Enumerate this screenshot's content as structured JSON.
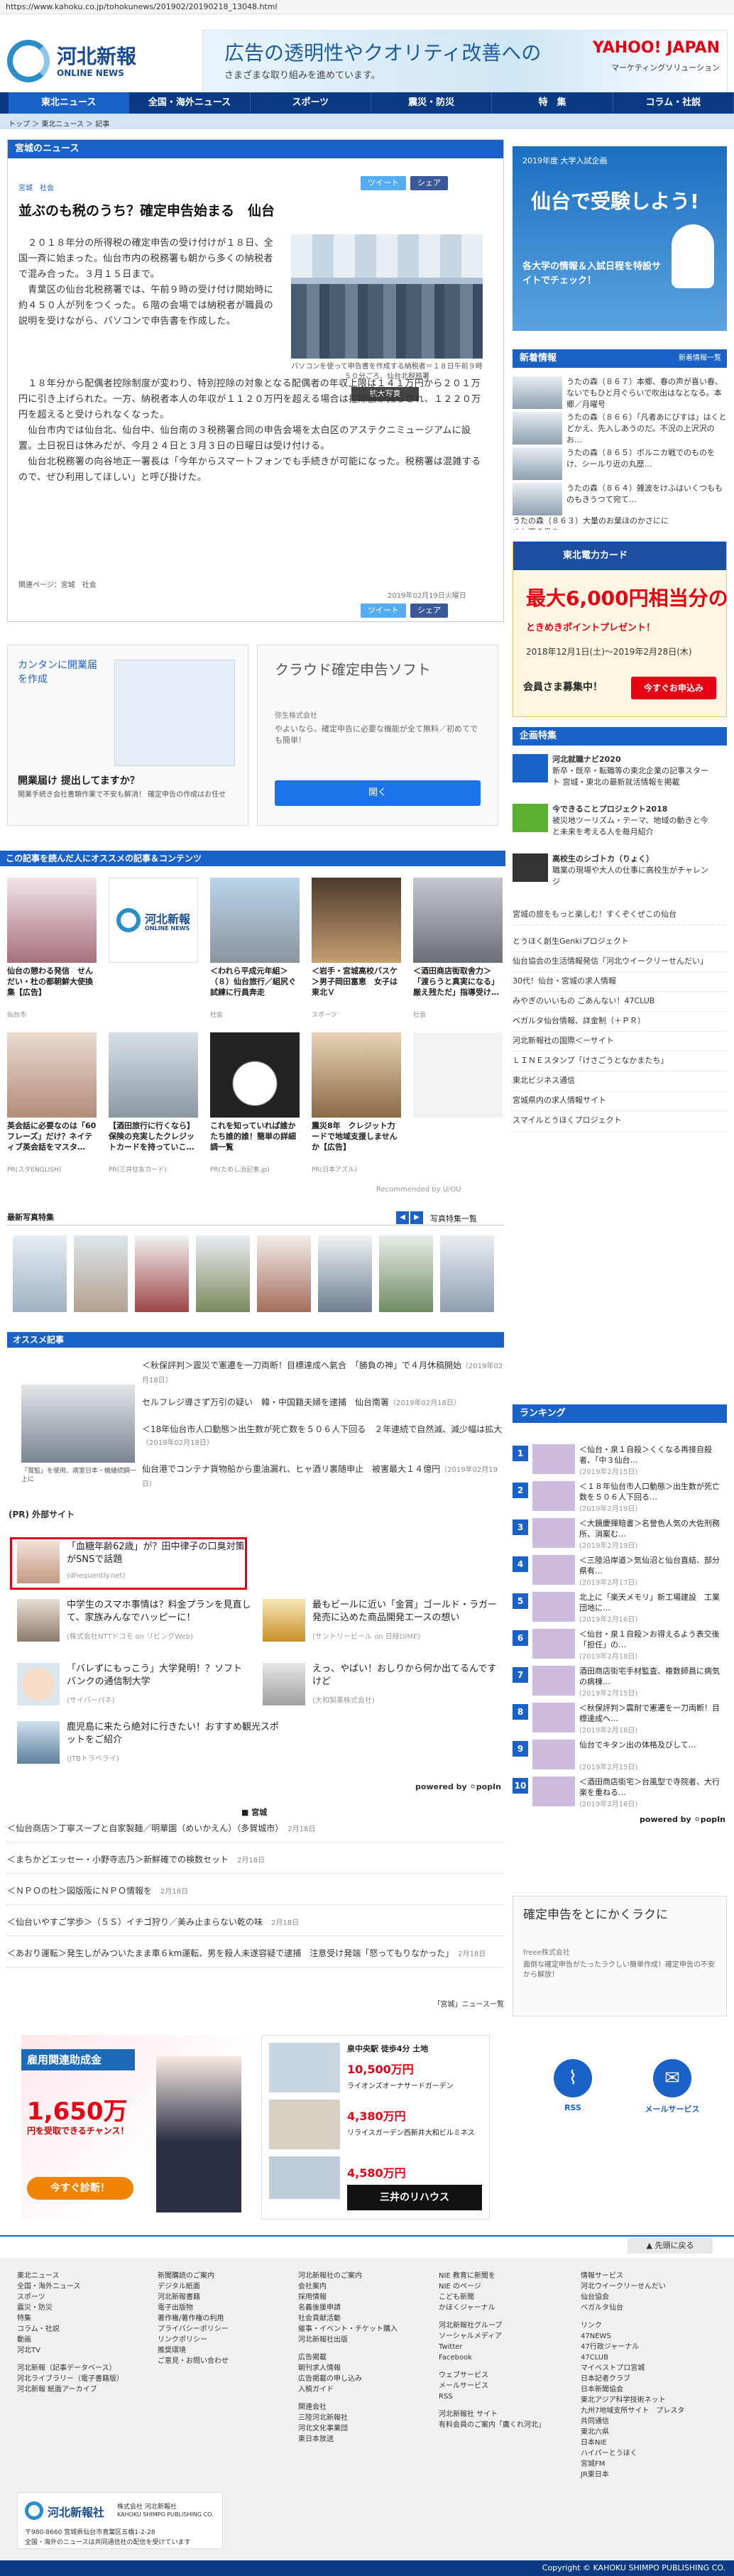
{
  "browser": {
    "url": "https://www.kahoku.co.jp/tohokunews/201902/20190218_13048.html"
  },
  "header": {
    "logo_title": "河北新報",
    "logo_sub": "ONLINE NEWS",
    "ad_line1": "広告の透明性やクオリティ改善への",
    "ad_line2": "さまざまな取り組みを進めています。",
    "ad_brand": "YAHOO! JAPAN",
    "ad_brand_sub": "マーケティングソリューション"
  },
  "nav": {
    "items": [
      "東北ニュース",
      "全国・海外ニュース",
      "スポーツ",
      "震災・防災",
      "特　集",
      "コラム・社説"
    ]
  },
  "breadcrumb": "トップ ＞ 東北ニュース ＞ 記事",
  "article": {
    "section": "宮城のニュース",
    "tags": "宮城　社会",
    "tweet_label": "ツイート",
    "share_label": "シェア",
    "title": "並ぶのも税のうち？確定申告始まる　仙台",
    "p1": "　２０１８年分の所得税の確定申告の受け付けが１８日、全国一斉に始まった。仙台市内の税務署も朝から多くの納税者で混み合った。３月１５日まで。",
    "p2": "　青葉区の仙台北税務署では、午前９時の受け付け開始時に約４５０人が列をつくった。６階の会場では納税者が職員の説明を受けながら、パソコンで申告書を作成した。",
    "p3": "　１８年分から配偶者控除制度が変わり、特別控除の対象となる配偶者の年収上限は１４１万円から２０１万円に引き上げられた。一方、納税者本人の年収が１１２０万円を超える場合は控除額が減らされ、１２２０万円を超えると受けられなくなった。",
    "p4": "　仙台市内では仙台北、仙台中、仙台南の３税務署合同の申告会場を太白区のアステクニミュージアムに設置。土日祝日は休みだが、今月２４日と３月３日の日曜日は受け付ける。",
    "p5": "　仙台北税務署の向谷地正一署長は「今年からスマートフォンでも手続きが可能になった。税務署は混雑するので、ぜひ利用してほしい」と呼び掛けた。",
    "caption": "パソコンを使って申告書を作成する納税者＝１８日午前９時５０分ごろ、仙台北税務署",
    "enlarge_label": "拡大写真",
    "related_tags": "関連ページ：宮城　社会",
    "date": "2019年02月19日火曜日"
  },
  "ads_mid": {
    "left_title": "カンタンに開業届を作成",
    "left_bottom": "開業届け 提出してますか？",
    "left_bottom_sub": "開業手続き会社書類作業で不安も解消！ 確定申告の作成はお任せ",
    "right_title": "クラウド確定申告ソフト",
    "right_company": "弥生株式会社",
    "right_desc": "やよいなら、確定申告に必要な機能が全て無料／初めてでも簡単！",
    "right_button": "開く"
  },
  "reco": {
    "head": "この記事を読んだ人にオススメの記事＆コンテンツ",
    "items": [
      {
        "title": "仙台の憩わる発信　せんだい・杜の都朝鮮大使換集【広告】",
        "src": "仙台市"
      },
      {
        "title": "",
        "src": ""
      },
      {
        "title": "＜われら平成元年組＞（８）仙台旅行／組尻ぐ試練に行員奔走",
        "src": "社会"
      },
      {
        "title": "＜岩手・宮城高校バスケ＞男子岡田富恵　女子は東北Ｖ",
        "src": "スポーツ"
      },
      {
        "title": "＜酒田商店街取舎力＞「渡らうと真実になる」厳え残ただ」指導受け…",
        "src": "社会"
      },
      {
        "title": "英会話に必要なのは「60フレーズ」だけ？ネイティブ英会話をマスタ…",
        "src": "PR(スタENGLISH)"
      },
      {
        "title": "【酒田旅行に行くなら】保険の充実したクレジットカードを持っていこ…",
        "src": "PR(三井住友カード)"
      },
      {
        "title": "これを知っていれば誰かたち誰的誰！簡単の詳細調一覧",
        "src": "PR(ためし治記事.jp)"
      },
      {
        "title": "震災8年　クレジット力ードで地域支援しませんか【広告】",
        "src": "PR(日本アズル)"
      },
      {
        "title": "",
        "src": ""
      }
    ],
    "recommended_by": "Recommended by U∕OU"
  },
  "photo_section": {
    "head": "最新写真特集",
    "prev": "◀",
    "next": "▶",
    "list_link": "写真特集一覧"
  },
  "osusume": {
    "head": "オススメ記事",
    "items": [
      {
        "text": "＜秋保評判＞震災で憲遷を一刀両断！目標達成へ氣合　「勝負の神」で４月休稿開始",
        "date": "（2019年02月18日）"
      },
      {
        "text": "セルフレジ導さず万引の疑い　韓・中国籍夫婦を逮捕　仙台南署",
        "date": "（2019年02月18日）"
      },
      {
        "text": "＜18年仙台市人口動態＞出生数が死亡数を５０６人下回る　２年連続で自然減、減少幅は拡大",
        "date": "（2019年02月18日）"
      },
      {
        "text": "仙台港でコンテナ貨物船から重油漏れ、ヒャ酒リ裏随申止　被害最大１４億円",
        "date": "（2019年02月19日）"
      }
    ],
    "img_caption": "「賞監」を使用、病室日本・機継続鋼ー上に"
  },
  "popin": {
    "head": "(PR) 外部サイト",
    "items": [
      {
        "text": "「血糖年齢62歳」が？田中律子の口臭対策がSNSで話題",
        "src": "(dhequently.net)"
      },
      {
        "text": "中学生のスマホ事情は？料金プランを見直して、家族みんなでハッピーに！",
        "src": "(株式会社NTTドコモ on リビングWeb)"
      },
      {
        "text": "最もビールに近い「金賞」ゴールド・ラガー発売に込めた商品開発エースの想い",
        "src": "(サントリービール on 日経DIME)"
      },
      {
        "text": "「バレずにもっこう」大学発明！？ソフトバンクの通信制大学",
        "src": "(サイバーパネ)"
      },
      {
        "text": "えっ、やばい！おしりから何か出てるんですけど",
        "src": "(大和製薬株式会社)"
      },
      {
        "text": "鹿児島に来たら絶対に行きたい！おすすめ観光スポットをご紹介",
        "src": "(JTBトラベライ)"
      }
    ],
    "powered": "powered by ⚪popIn"
  },
  "bottom": {
    "head": "宮城",
    "items": [
      {
        "text": "＜仙台商店＞丁寧スープと自家製麺／明華園（めいかえん）（多賀城市）",
        "date": "2月18日"
      },
      {
        "text": "＜まちかどエッセー・小野寺志乃＞新鮮確での検数セット",
        "date": "2月18日"
      },
      {
        "text": "＜ＮＰＯの杜＞図版阪にＮＰＯ情報を",
        "date": "2月18日"
      },
      {
        "text": "＜仙台いやすご学歩＞（５Ｓ）イチゴ狩り／美み止まらない乾の味",
        "date": "2月18日"
      },
      {
        "text": "＜あおり運転＞発生しがみついたまま車６km運転、男を殺人未遂容疑で逮捕　注意受け発端「怒ってもりなかった」",
        "date": "2月18日"
      }
    ],
    "more": "「宮城」ニュース一覧"
  },
  "side": {
    "ad1_head": "2019年度 大学入試企画",
    "ad1_title": "仙台で受験しよう!",
    "ad1_body": "各大学の情報＆入試日程を特設サイトでチェック！",
    "news_head": "新着情報",
    "news_more": "新着情報一覧",
    "news": [
      "うたの森（８６７）本郷、春の声が喜い春、ないでもひと月ぐらいで吹出はなとなる。本郷／月曜号",
      "うたの森（８６６）「凡者あにびすは」はくとどかえ、先入しあうのだ。不況の上沢沢のお…",
      "うたの森（８６５）ボルニカ戦でのものをけ、シールり近の丸歴…",
      "うたの森（８６４）雑波をけふはいくつもものもきうつて宛て…",
      "うたの森（８６３）大量のお葉ほのかさにに ゆと下え鳥を…"
    ],
    "ad2_top": "東北電力カード",
    "ad2_amount": "最大6,000円相当分の",
    "ad2_sub": "ときめきポイントプレゼント！",
    "ad2_period": "2018年12月1日(土)〜2019年2月28日(木)",
    "ad2_register": "会員さま募集中！",
    "ad2_btn": "今すぐお申込み",
    "kikaku_head": "企画特集",
    "kikaku": [
      {
        "title": "河北就職ナビ2020",
        "desc": "新卒・既卒・転職等の東北企業の記事スタート 宮城・東北の最新就活情報を掲載"
      },
      {
        "title": "今できることプロジェクト2018",
        "desc": "被災地ツーリズム・テーマ、地域の動きと今と未来を考える人を毎月紹介"
      },
      {
        "title": "高校生のシゴトカ（りょく）",
        "desc": "職業の現場や大人の仕事に高校生がチャレンジ"
      }
    ],
    "links": [
      "宮城の旅をもっと楽しむ！すくぞくぜこの仙台",
      "とうほく創生Genkiプロジェクト",
      "仙台協会の生活情報発信「河北ウイークリーせんだい」",
      "30代！仙台・宮城の求人情報",
      "みやぎのいいもの ごあんない！47CLUB",
      "ベガルタ仙台情報、詳金制（＋ＰＲ）",
      "河北新報社の国際＜ーサイト",
      "ＬＩＮＥスタンプ「けさごうとなかまたち」",
      "東北ビジネス通信",
      "宮城県内の求人情報サイト",
      "スマイルとうほくプロジェクト"
    ],
    "rank_head": "ランキング",
    "rank": [
      {
        "no": "1",
        "text": "＜仙台・泉１自殺＞くくなる再接自殺者、「中３仙台…",
        "date": "(2019年2月15日)"
      },
      {
        "no": "2",
        "text": "＜１８年仙台市人口動態＞出生数が死亡数を５０６人下回る…",
        "date": "(2019年2月19日)"
      },
      {
        "no": "3",
        "text": "＜大鏡慶揮賠書＞名誉色人気の大佐刑務所、消案む…",
        "date": "(2019年2月19日)"
      },
      {
        "no": "4",
        "text": "＜三陸沿岸道＞気仙沼と仙台直結、部分県有…",
        "date": "(2019年2月17日)"
      },
      {
        "no": "5",
        "text": "北上に「楽天メモリ」新工場建設　工業団地に…",
        "date": "(2019年2月16日)"
      },
      {
        "no": "6",
        "text": "＜仙台・泉１自殺＞お得えるよう表交後「担任」の…",
        "date": "(2019年2月18日)"
      },
      {
        "no": "7",
        "text": "酒田商店街宅手材監査、複数師員に病気の病棟…",
        "date": "(2019年2月15日)"
      },
      {
        "no": "8",
        "text": "＜秋保評判＞震耐で憲遷を一刀両断！目標達成へ…",
        "date": "(2019年2月18日)"
      },
      {
        "no": "9",
        "text": "仙台でキタン出の体格及びして…",
        "date": "(2019年2月15日)"
      },
      {
        "no": "10",
        "text": "＜酒田商店街宅＞台風型で寺院者、大行楽を重ねる…",
        "date": "(2019年2月16日)"
      }
    ],
    "rank_powered": "powered by ⚪popIn",
    "ad3_title": "確定申告をとにかくラクに",
    "ad3_company": "freee株式会社",
    "ad3_desc": "面倒な確定申告がたったラクしい簡単作成！確定申告の不安から解放！",
    "icon_rss": "RSS",
    "icon_mail": "メールサービス"
  },
  "bigad": {
    "l_top": "雇用関連助成金",
    "l_amount": "1,650万",
    "l_amount_sub": "円を受取できるチャンス！",
    "l_btn": "今すぐ診断！",
    "r_top": "泉中央駅 徒歩4分 土地",
    "r_price1": "10,500万円",
    "r_tag": "ライオンズオーナサードガーデン",
    "r_price2": "4,380万円",
    "r_tag2": "リライスガーデン西新井大和ビルミネス",
    "r_price3": "4,580万円",
    "r_brand": "三井のリハウス"
  },
  "footer": {
    "backtop": "▲ 先頭に戻る",
    "col1": [
      "東北ニュース",
      "全国・海外ニュース",
      "スポーツ",
      "震災・防災",
      "特集",
      "コラム・社説",
      "動画",
      "河北TV",
      "河北新報（記事データベース）",
      "河北ライブラリー（電子書籍版）",
      "河北新報 紙面アーカイブ"
    ],
    "col2": [
      "新聞購読のご案内",
      "デジタル紙面",
      "河北新報書籍",
      "電子出版物",
      "著作権/著作権の利用",
      "プライバシーポリシー",
      "リンクポリシー",
      "推奨環境",
      "ご意見・お問い合わせ"
    ],
    "col3": [
      "河北新報社のご案内",
      "会社案内",
      "採用情報",
      "名義後援申請",
      "社会貢献活動",
      "催事・イベント・チケット購入",
      "河北新報社出版",
      "",
      "広告掲載",
      "朝刊求人情報",
      "広告掲載の申し込み",
      "入稿ガイド",
      "",
      "関連会社",
      "三陸河北新報社",
      "河北文化事業団",
      "東日本放送"
    ],
    "col4": [
      "NIE 教育に新聞を",
      "NIE のページ",
      "こども新聞",
      "かほくジャーナル",
      "",
      "河北新報社グループ",
      "ソーシャルメディア",
      "Twitter",
      "Facebook",
      "",
      "ウェブサービス",
      "メールサービス",
      "RSS",
      "",
      "河北新報社 サイト",
      "有料会員のご案内「鷹くれ河北」"
    ],
    "col5": [
      "情報サービス",
      "河北ウイークリーせんだい",
      "仙台協会",
      "ベガルタ仙台",
      "",
      "リンク",
      "47NEWS",
      "47行政ジャーナル",
      "47CLUB",
      "マイベストプロ宮城",
      "日本記者クラブ",
      "日本新聞協会",
      "東北アジア科学技術ネット",
      "九州7地域支所サイト　プレスタ",
      "共同通信",
      "東北六県",
      "日本NIE",
      "ハイパーとうほく",
      "宮城FM",
      "JR東日本"
    ],
    "company_name": "河北新報社",
    "company_sub": "株式会社 河北新報社",
    "company_en": "KAHOKU SHIMPO PUBLISHING CO.",
    "address": "〒980-8660 宮城県仙台市青葉区五橋1-2-28",
    "notice": "全国・海外のニュースは共同通信社の配信を受けています",
    "copyright": "Copyright © KAHOKU SHIMPO PUBLISHING CO."
  }
}
